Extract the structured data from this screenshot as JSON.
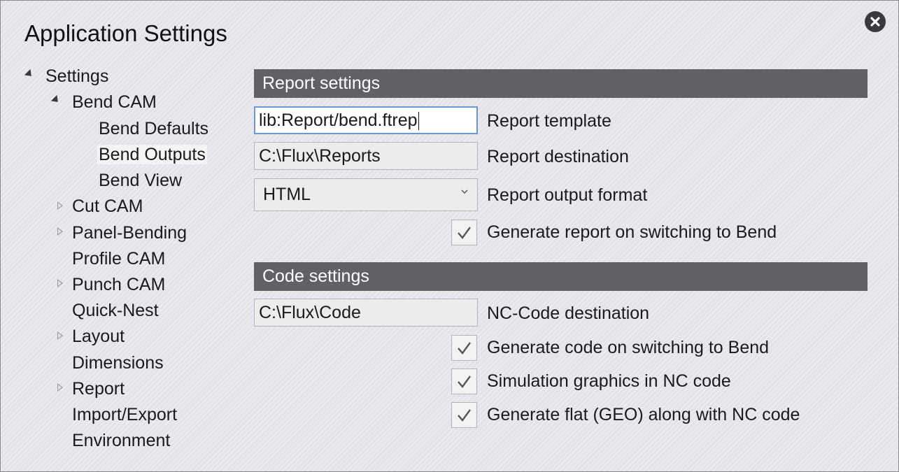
{
  "dialog": {
    "title": "Application Settings"
  },
  "tree": {
    "root": "Settings",
    "bend_cam": "Bend CAM",
    "bend_defaults": "Bend Defaults",
    "bend_outputs": "Bend Outputs",
    "bend_view": "Bend View",
    "cut_cam": "Cut CAM",
    "panel_bending": "Panel-Bending",
    "profile_cam": "Profile CAM",
    "punch_cam": "Punch CAM",
    "quick_nest": "Quick-Nest",
    "layout": "Layout",
    "dimensions": "Dimensions",
    "report": "Report",
    "import_export": "Import/Export",
    "environment": "Environment",
    "selected": "Bend Outputs"
  },
  "report_settings": {
    "header": "Report settings",
    "template_value": "lib:Report/bend.ftrep",
    "template_label": "Report template",
    "destination_value": "C:\\Flux\\Reports",
    "destination_label": "Report destination",
    "format_value": "HTML",
    "format_label": "Report output format",
    "generate_on_switch_label": "Generate report on switching to Bend",
    "generate_on_switch_checked": true
  },
  "code_settings": {
    "header": "Code settings",
    "destination_value": "C:\\Flux\\Code",
    "destination_label": "NC-Code destination",
    "generate_code_label": "Generate code on switching to Bend",
    "generate_code_checked": true,
    "simulation_label": "Simulation graphics in NC code",
    "simulation_checked": true,
    "generate_flat_label": "Generate flat (GEO) along with NC code",
    "generate_flat_checked": true
  },
  "icons": {
    "close": "close-icon",
    "expanded": "expanded-triangle-icon",
    "collapsed": "collapsed-triangle-icon",
    "dropdown": "chevron-down-icon",
    "check": "checkmark-icon"
  },
  "colors": {
    "section_header_bg": "#606066",
    "dialog_bg": "#e3e3ea",
    "focus_border": "#6a9ad6"
  }
}
